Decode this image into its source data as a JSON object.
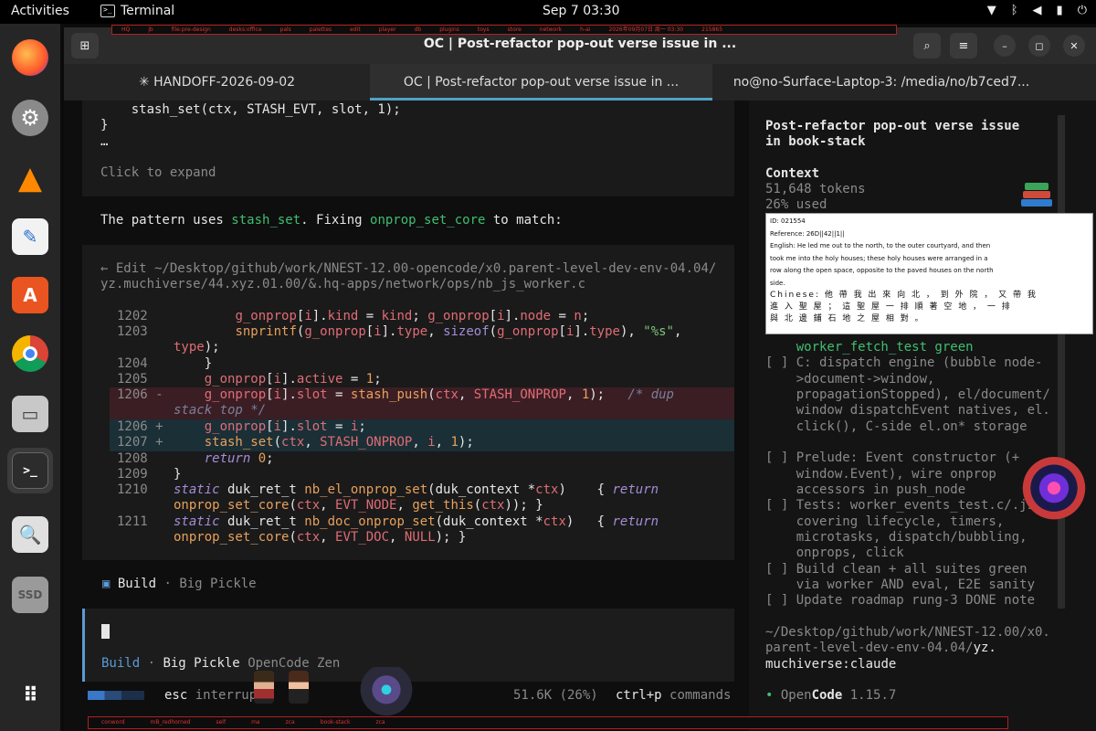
{
  "topbar": {
    "activities": "Activities",
    "app_name": "Terminal",
    "clock": "Sep 7  03:30",
    "tray": [
      "wifi",
      "bluetooth",
      "volume",
      "battery",
      "power"
    ]
  },
  "window": {
    "title": "OC | Post-refactor pop-out verse issue in ..."
  },
  "strip_labels": [
    "HQ",
    "jb",
    "file:pre-design",
    "desks:office",
    "pals",
    "palettes",
    "edit",
    "player",
    "db",
    "plugins",
    "toys",
    "store",
    "network",
    "h-ai",
    "2026年09月07日 周一 03:30",
    "215865"
  ],
  "tabs": [
    {
      "label": "✳ HANDOFF-2026-09-02",
      "active": false
    },
    {
      "label": "OC | Post-refactor pop-out verse issue in ...",
      "active": true
    },
    {
      "label": "no@no-Surface-Laptop-3: /media/no/b7ced7...",
      "active": false
    }
  ],
  "main": {
    "code1": "    stash_set(ctx, STASH_EVT, slot, 1);",
    "code2": "}",
    "code3": "…",
    "expand": "Click to expand",
    "pattern_pre": "The pattern uses ",
    "pattern_fn1": "stash_set",
    "pattern_mid": ". Fixing ",
    "pattern_fn2": "onprop_set_core",
    "pattern_post": " to match:",
    "edit_line1": "← Edit ~/Desktop/github/work/NNEST-12.00-opencode/x0.parent-level-dev-env-04.04/",
    "edit_line2": "yz.muchiverse/44.xyz.01.00/&.hq-apps/network/ops/nb_js_worker.c",
    "build_label": "Build",
    "build_sep": " · ",
    "build_model": "Big Pickle",
    "input_build": "Build",
    "input_model": "Big Pickle",
    "input_provider": "OpenCode Zen",
    "status_esc": "esc",
    "status_interrupt": "interrupt",
    "status_tokens": "51.6K (26%)",
    "status_cmd_key": "ctrl+p",
    "status_cmd": "commands"
  },
  "diff": {
    "n1202": "1202",
    "n1203": "1203",
    "n1204": "1204",
    "n1205": "1205",
    "n1206d": "1206 -",
    "n1206a": "1206 +",
    "n1207a": "1207 +",
    "n1208": "1208",
    "n1209": "1209",
    "n1210": "1210",
    "n1211": "1211"
  },
  "sidebar": {
    "title1": "Post-refactor pop-out verse issue",
    "title2": "in book-stack",
    "context_h": "Context",
    "tokens": "51,648 tokens",
    "used": "26% used",
    "t1": "    worker_fetch_test green",
    "t2": "[ ] C: dispatch engine (bubble node-",
    "t3": "    >document->window,",
    "t4": "    propagationStopped), el/document/",
    "t5": "    window dispatchEvent natives, el.",
    "t6": "    click(), C-side el.on* storage",
    "t7": "[ ] Prelude: Event constructor (+",
    "t8": "    window.Event), wire onprop",
    "t9": "    accessors in push_node",
    "t10": "[ ] Tests: worker_events_test.c/.js",
    "t11": "    covering lifecycle, timers,",
    "t12": "    microtasks, dispatch/bubbling,",
    "t13": "    onprops, click",
    "t14": "[ ] Build clean + all suites green",
    "t15": "    via worker AND eval, E2E sanity",
    "t16": "[ ] Update roadmap rung-3 DONE note",
    "path1": "~/Desktop/github/work/NNEST-12.00/x0.",
    "path2": "parent-level-dev-env-04.04/",
    "path2b": "yz.",
    "path3": "muchiverse",
    "path3b": ":claude",
    "brand_open": "Open",
    "brand_code": "Code",
    "version": " 1.15.7"
  },
  "popup": {
    "id": "ID: 021554",
    "ref": "Reference: 26D||42||1||",
    "en1": "English: He led me out to the north, to the outer courtyard, and then",
    "en2": "took me into the holy houses; these holy houses were arranged in a",
    "en3": "row along the open space, opposite to the paved houses on the north",
    "en4": "side.",
    "zh1": "Chinese: 他 帶 我 出 來 向 北 ， 到 外 院 ， 又 帶 我",
    "zh2": "進 入 聖 屋 ； 這 聖 屋 一 排 順 著 空 地 ， 一 排",
    "zh3": "與 北 邊 鋪 石 地 之 屋 相 對 。"
  },
  "bottom_strip": [
    "conword",
    "mB_redhorned",
    "self",
    "ma",
    "zca",
    "book-stack",
    "zca"
  ],
  "colors": {
    "accent": "#4fa3c4",
    "diff_add": "#1b2f36",
    "diff_del": "#3a1e24",
    "build_blue": "#5b9bd5"
  }
}
